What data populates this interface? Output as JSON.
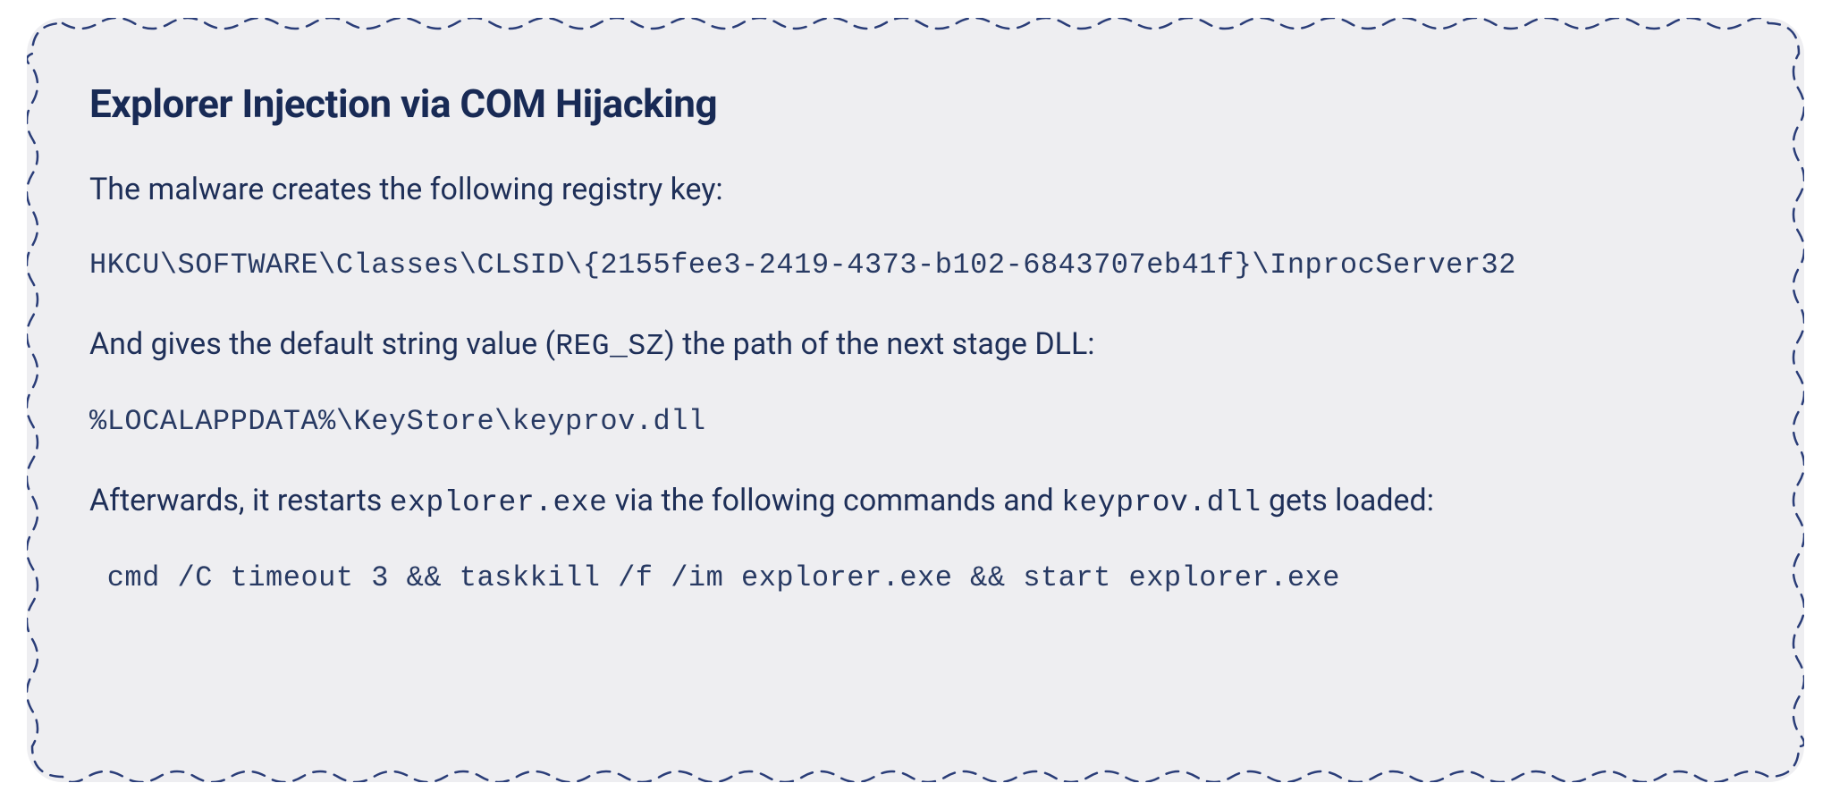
{
  "title": "Explorer Injection via COM Hijacking",
  "p1": "The malware creates the following registry key:",
  "code1": "HKCU\\SOFTWARE\\Classes\\CLSID\\{2155fee3-2419-4373-b102-6843707eb41f}\\InprocServer32",
  "p2_a": "And gives the default string value (",
  "p2_reg": "REG_SZ",
  "p2_b": ") the path of the next stage DLL:",
  "code2": "%LOCALAPPDATA%\\KeyStore\\keyprov.dll",
  "p3_a": "Afterwards, it restarts ",
  "p3_exe": "explorer.exe",
  "p3_b": " via the following commands and ",
  "p3_dll": "keyprov.dll",
  "p3_c": " gets loaded:",
  "code3": " cmd /C timeout 3 && taskkill /f /im explorer.exe && start explorer.exe"
}
